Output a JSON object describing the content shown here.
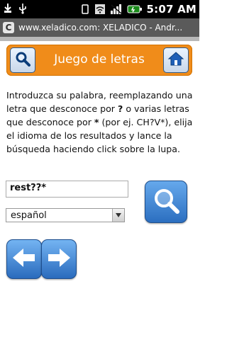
{
  "status_bar": {
    "time": "5:07 AM"
  },
  "window": {
    "title": "www.xeladico.com: XELADICO - Andr...",
    "app_icon_text": "C"
  },
  "header": {
    "title": "Juego de letras"
  },
  "instructions": {
    "part1": "Introduzca su palabra, reemplazando una letra que desconoce por ",
    "q": "?",
    "part2": " o varias letras que desconoce por ",
    "star": "*",
    "part3": " (por ej. CH?V*), elija el idioma de los resultados y lance la búsqueda haciendo click sobre la lupa."
  },
  "search": {
    "value": "rest??*"
  },
  "language": {
    "selected": "español"
  },
  "colors": {
    "accent_orange": "#f08c1a",
    "button_blue": "#2c6fc0",
    "title_bar": "#5a5a5a"
  }
}
